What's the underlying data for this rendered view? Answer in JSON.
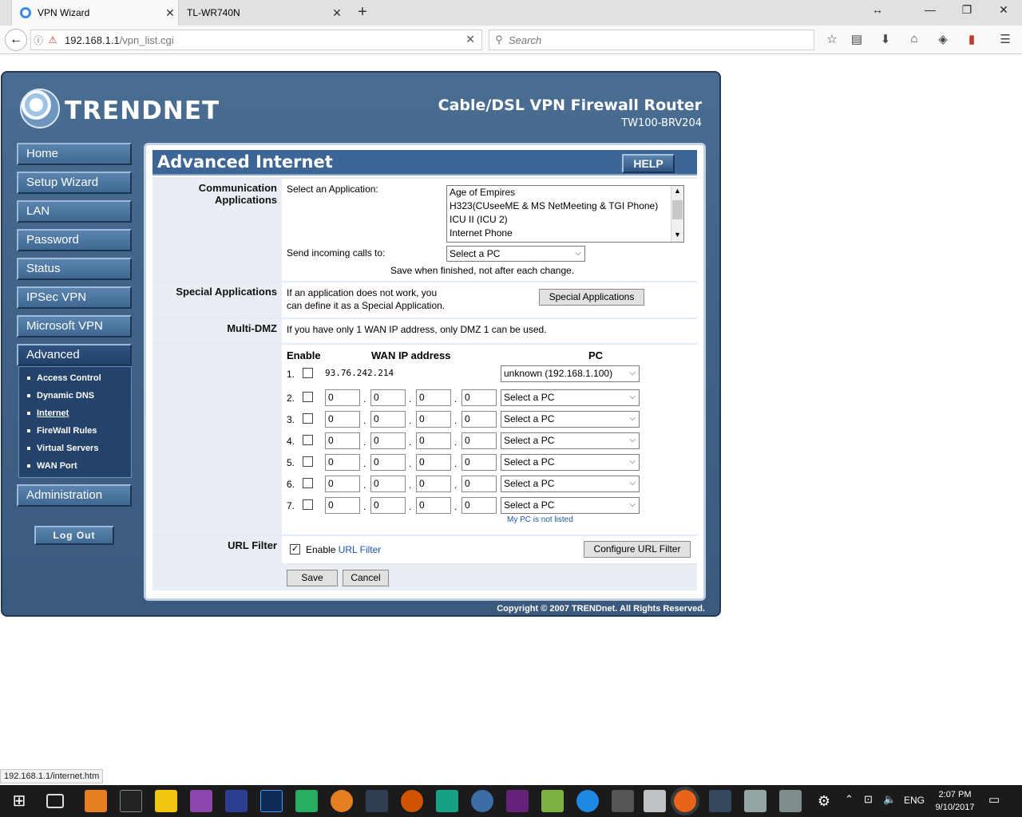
{
  "browser": {
    "tabs": [
      {
        "label": "VPN Wizard",
        "active": true
      },
      {
        "label": "TL-WR740N",
        "active": false
      }
    ],
    "url_host": "192.168.1.1",
    "url_path": "/vpn_list.cgi",
    "search_placeholder": "Search",
    "status_url": "192.168.1.1/internet.htm"
  },
  "header": {
    "logo_text": "TRENDNET",
    "product": "Cable/DSL VPN Firewall Router",
    "model": "TW100-BRV204"
  },
  "sidenav": {
    "items": [
      "Home",
      "Setup Wizard",
      "LAN",
      "Password",
      "Status",
      "IPSec VPN",
      "Microsoft VPN",
      "Advanced",
      "Administration"
    ],
    "sub_items": [
      "Access Control",
      "Dynamic DNS",
      "Internet",
      "FireWall Rules",
      "Virtual Servers",
      "WAN Port"
    ],
    "logout": "Log Out"
  },
  "main": {
    "title": "Advanced Internet",
    "help": "HELP",
    "comm": {
      "label": "Communication Applications",
      "select_label": "Select an Application:",
      "apps": [
        "Age of Empires",
        "H323(CUseeME & MS NetMeeting & TGI Phone)",
        "ICU II (ICU 2)",
        "Internet Phone"
      ],
      "incoming_label": "Send incoming calls to:",
      "incoming_value": "Select a PC",
      "note": "Save when finished, not after each change."
    },
    "special": {
      "label": "Special Applications",
      "text_1": "If an application does not work, you",
      "text_2": "can define it as a Special Application.",
      "button": "Special Applications"
    },
    "dmz": {
      "label": "Multi-DMZ",
      "text": "If you have only 1 WAN IP address, only DMZ 1 can be used.",
      "col_enable": "Enable",
      "col_wan": "WAN IP address",
      "col_pc": "PC",
      "row1_num": "1.",
      "row1_ip": "93.76.242.214",
      "row1_pc": "unknown (192.168.1.100)",
      "rows": [
        {
          "num": "2.",
          "o1": "0",
          "o2": "0",
          "o3": "0",
          "o4": "0",
          "pc": "Select a PC"
        },
        {
          "num": "3.",
          "o1": "0",
          "o2": "0",
          "o3": "0",
          "o4": "0",
          "pc": "Select a PC"
        },
        {
          "num": "4.",
          "o1": "0",
          "o2": "0",
          "o3": "0",
          "o4": "0",
          "pc": "Select a PC"
        },
        {
          "num": "5.",
          "o1": "0",
          "o2": "0",
          "o3": "0",
          "o4": "0",
          "pc": "Select a PC"
        },
        {
          "num": "6.",
          "o1": "0",
          "o2": "0",
          "o3": "0",
          "o4": "0",
          "pc": "Select a PC"
        },
        {
          "num": "7.",
          "o1": "0",
          "o2": "0",
          "o3": "0",
          "o4": "0",
          "pc": "Select a PC"
        }
      ],
      "not_listed": "My PC is not listed"
    },
    "url_filter": {
      "label": "URL Filter",
      "enable_text": "Enable",
      "link_text": "URL Filter",
      "button": "Configure URL Filter",
      "checked": true
    },
    "save": "Save",
    "cancel": "Cancel"
  },
  "footer": "Copyright © 2007 TRENDnet. All Rights Reserved.",
  "taskbar": {
    "time": "2:07 PM",
    "date": "9/10/2017",
    "lang": "ENG"
  },
  "colors": {
    "frame": "#4a6d92",
    "title_bar": "#3d6596",
    "label_bg": "#e9eef4",
    "link": "#1a56b0"
  }
}
